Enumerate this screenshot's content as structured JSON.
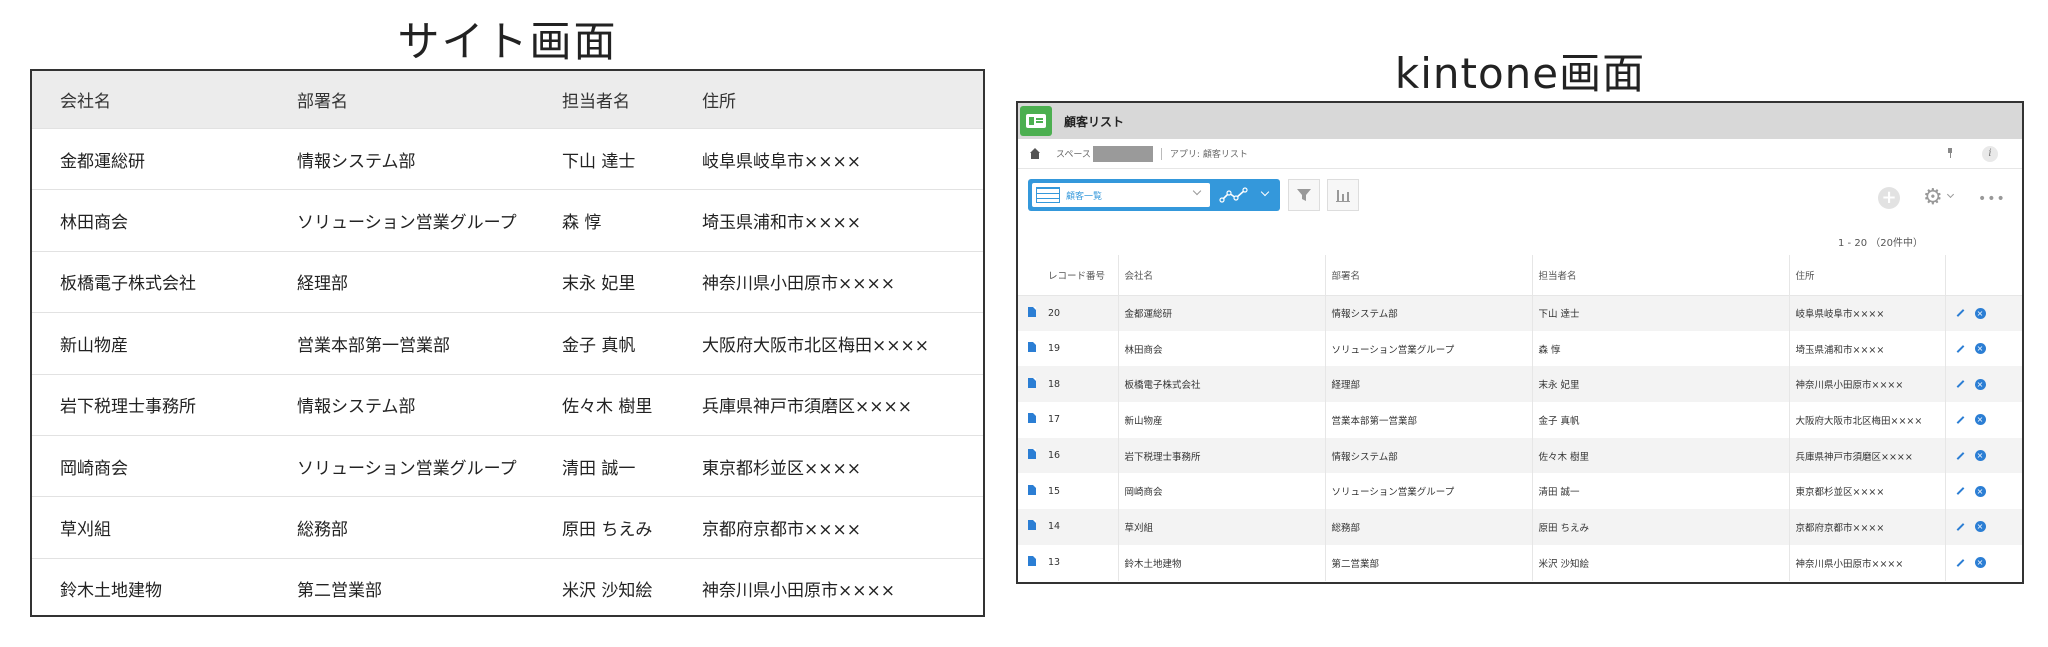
{
  "site": {
    "caption": "サイト画面",
    "headers": [
      "会社名",
      "部署名",
      "担当者名",
      "住所"
    ],
    "rows": [
      [
        "金都運総研",
        "情報システム部",
        "下山 達士",
        "岐阜県岐阜市××××"
      ],
      [
        "林田商会",
        "ソリューション営業グループ",
        "森 惇",
        "埼玉県浦和市××××"
      ],
      [
        "板橋電子株式会社",
        "経理部",
        "末永 妃里",
        "神奈川県小田原市××××"
      ],
      [
        "新山物産",
        "営業本部第一営業部",
        "金子 真帆",
        "大阪府大阪市北区梅田××××"
      ],
      [
        "岩下税理士事務所",
        "情報システム部",
        "佐々木 樹里",
        "兵庫県神戸市須磨区××××"
      ],
      [
        "岡崎商会",
        "ソリューション営業グループ",
        "清田 誠一",
        "東京都杉並区××××"
      ],
      [
        "草刈組",
        "総務部",
        "原田 ちえみ",
        "京都府京都市××××"
      ],
      [
        "鈴木土地建物",
        "第二営業部",
        "米沢 沙知絵",
        "神奈川県小田原市××××"
      ]
    ]
  },
  "kintone": {
    "caption": "kintone画面",
    "app_title": "顧客リスト",
    "breadcrumb": {
      "space_label": "スペース",
      "app_label": "アプリ: 顧客リスト"
    },
    "info_icon_text": "i",
    "view_name": "顧客一覧",
    "plus_text": "+",
    "gear_text": "⚙",
    "more_text": "•••",
    "count_text": "1 - 20 （20件中）",
    "headers": [
      "レコード番号",
      "会社名",
      "部署名",
      "担当者名",
      "住所"
    ],
    "delete_icon_text": "×",
    "rows": [
      [
        "20",
        "金都運総研",
        "情報システム部",
        "下山 達士",
        "岐阜県岐阜市××××"
      ],
      [
        "19",
        "林田商会",
        "ソリューション営業グループ",
        "森 惇",
        "埼玉県浦和市××××"
      ],
      [
        "18",
        "板橋電子株式会社",
        "経理部",
        "末永 妃里",
        "神奈川県小田原市××××"
      ],
      [
        "17",
        "新山物産",
        "営業本部第一営業部",
        "金子 真帆",
        "大阪府大阪市北区梅田××××"
      ],
      [
        "16",
        "岩下税理士事務所",
        "情報システム部",
        "佐々木 樹里",
        "兵庫県神戸市須磨区××××"
      ],
      [
        "15",
        "岡崎商会",
        "ソリューション営業グループ",
        "清田 誠一",
        "東京都杉並区××××"
      ],
      [
        "14",
        "草刈組",
        "総務部",
        "原田 ちえみ",
        "京都府京都市××××"
      ],
      [
        "13",
        "鈴木土地建物",
        "第二営業部",
        "米沢 沙知絵",
        "神奈川県小田原市××××"
      ]
    ]
  },
  "colors": {
    "kintone_blue": "#3498db",
    "app_icon_green": "#4caf50",
    "site_header_bg": "#ececec"
  }
}
